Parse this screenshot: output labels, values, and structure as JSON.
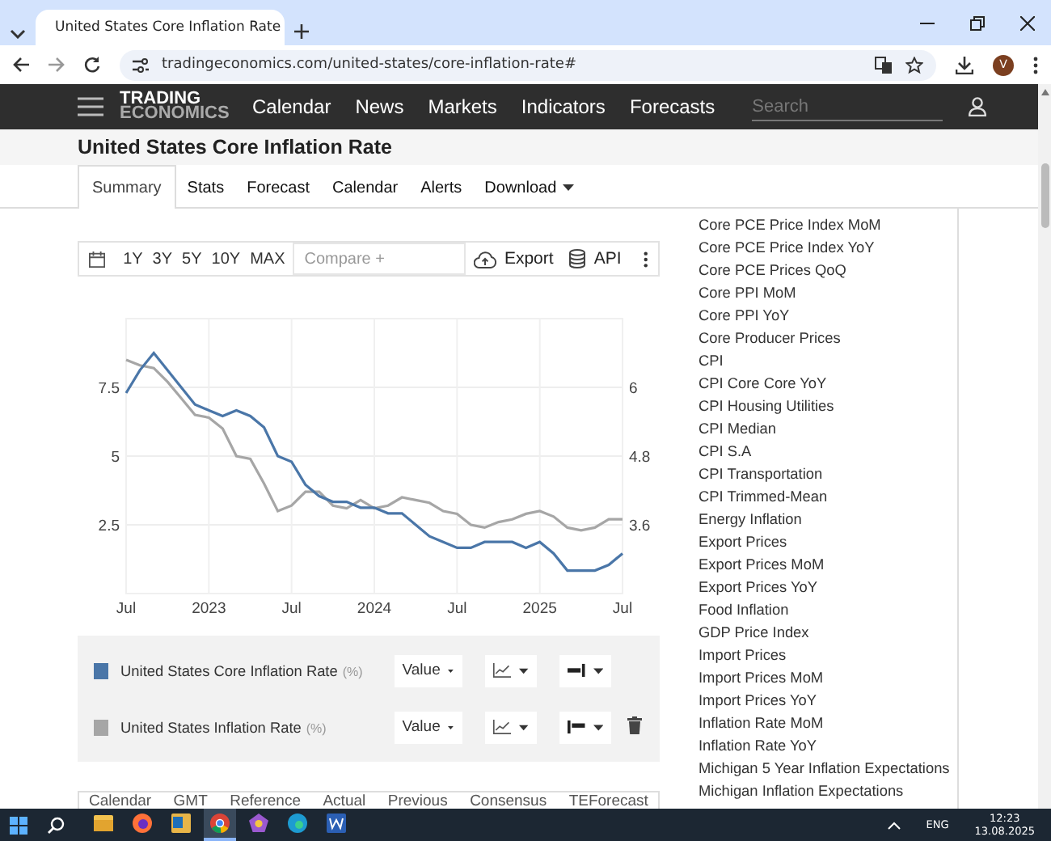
{
  "browser": {
    "tab": {
      "title": "United States Core Inflation Rate"
    },
    "url": "tradingeconomics.com/united-states/core-inflation-rate#",
    "profile_initial": "V"
  },
  "site_nav": {
    "logo": [
      "TRADING",
      "ECONOMICS"
    ],
    "links": [
      "Calendar",
      "News",
      "Markets",
      "Indicators",
      "Forecasts"
    ],
    "search": {
      "placeholder": "Search"
    }
  },
  "page_title": "United States Core Inflation Rate",
  "tabs": [
    {
      "label": "Summary",
      "selected": true,
      "dropdown": false
    },
    {
      "label": "Stats",
      "selected": false,
      "dropdown": false
    },
    {
      "label": "Forecast",
      "selected": false,
      "dropdown": false
    },
    {
      "label": "Calendar",
      "selected": false,
      "dropdown": false
    },
    {
      "label": "Alerts",
      "selected": false,
      "dropdown": false
    },
    {
      "label": "Download",
      "selected": false,
      "dropdown": true
    }
  ],
  "chart_toolbar": {
    "ranges": [
      "1Y",
      "3Y",
      "5Y",
      "10Y",
      "MAX"
    ],
    "compare": "Compare +",
    "export": "Export",
    "api": "API"
  },
  "chart": {
    "chart_data": {
      "type": "line",
      "x": [
        "2022-07",
        "2022-08",
        "2022-09",
        "2022-10",
        "2022-11",
        "2022-12",
        "2023-01",
        "2023-02",
        "2023-03",
        "2023-04",
        "2023-05",
        "2023-06",
        "2023-07",
        "2023-08",
        "2023-09",
        "2023-10",
        "2023-11",
        "2023-12",
        "2024-01",
        "2024-02",
        "2024-03",
        "2024-04",
        "2024-05",
        "2024-06",
        "2024-07",
        "2024-08",
        "2024-09",
        "2024-10",
        "2024-11",
        "2024-12",
        "2025-01",
        "2025-02",
        "2025-03",
        "2025-04",
        "2025-05",
        "2025-06",
        "2025-07"
      ],
      "series": [
        {
          "name": "United States Core Inflation Rate",
          "color": "#4a76a8",
          "axis": "y2",
          "values": [
            5.9,
            6.3,
            6.6,
            6.3,
            6.0,
            5.7,
            5.6,
            5.5,
            5.6,
            5.5,
            5.3,
            4.8,
            4.7,
            4.3,
            4.1,
            4.0,
            4.0,
            3.9,
            3.9,
            3.8,
            3.8,
            3.6,
            3.4,
            3.3,
            3.2,
            3.2,
            3.3,
            3.3,
            3.3,
            3.2,
            3.3,
            3.1,
            2.8,
            2.8,
            2.8,
            2.9,
            3.1
          ]
        },
        {
          "name": "United States Inflation Rate",
          "color": "#a6a6a6",
          "values": [
            8.5,
            8.3,
            8.2,
            7.7,
            7.1,
            6.5,
            6.4,
            6.0,
            5.0,
            4.9,
            4.0,
            3.0,
            3.2,
            3.7,
            3.7,
            3.2,
            3.1,
            3.4,
            3.1,
            3.2,
            3.5,
            3.4,
            3.3,
            3.0,
            2.9,
            2.5,
            2.4,
            2.6,
            2.7,
            2.9,
            3.0,
            2.8,
            2.4,
            2.3,
            2.4,
            2.7,
            2.7
          ]
        }
      ],
      "grid": true,
      "xlim": [
        "2022-07",
        "2025-07"
      ],
      "ylim": [
        0,
        10
      ],
      "yticks": [
        2.5,
        5,
        7.5
      ],
      "y2lim": [
        2.4,
        7.2
      ],
      "y2ticks": [
        3.6,
        4.8,
        6
      ],
      "xticks": [
        {
          "value": "2022-07",
          "label": "Jul"
        },
        {
          "value": "2023-01",
          "label": "2023"
        },
        {
          "value": "2023-07",
          "label": "Jul"
        },
        {
          "value": "2024-01",
          "label": "2024"
        },
        {
          "value": "2024-07",
          "label": "Jul"
        },
        {
          "value": "2025-01",
          "label": "2025"
        },
        {
          "value": "2025-07",
          "label": "Jul"
        }
      ]
    }
  },
  "legend": [
    {
      "unit": "(%)",
      "value_menu": "Value",
      "right_axis": true,
      "removable": false
    },
    {
      "unit": "(%)",
      "value_menu": "Value",
      "right_axis": false,
      "removable": true
    }
  ],
  "related_list": [
    "Core PCE Price Index MoM",
    "Core PCE Price Index YoY",
    "Core PCE Prices QoQ",
    "Core PPI MoM",
    "Core PPI YoY",
    "Core Producer Prices",
    "CPI",
    "CPI Core Core YoY",
    "CPI Housing Utilities",
    "CPI Median",
    "CPI S.A",
    "CPI Transportation",
    "CPI Trimmed-Mean",
    "Energy Inflation",
    "Export Prices",
    "Export Prices MoM",
    "Export Prices YoY",
    "Food Inflation",
    "GDP Price Index",
    "Import Prices",
    "Import Prices MoM",
    "Import Prices YoY",
    "Inflation Rate MoM",
    "Inflation Rate YoY",
    "Michigan 5 Year Inflation Expectations",
    "Michigan Inflation Expectations"
  ],
  "table": {
    "columns": [
      "Calendar",
      "GMT",
      "Reference",
      "Actual",
      "Previous",
      "Consensus",
      "TEForecast"
    ]
  },
  "taskbar": {
    "language": "ENG",
    "time": "12:23",
    "date": "13.08.2025"
  }
}
